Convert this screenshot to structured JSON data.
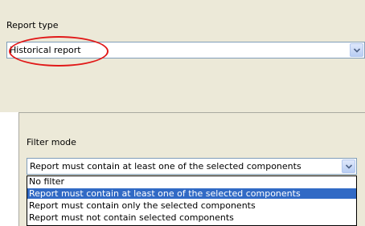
{
  "report": {
    "label": "Report type",
    "selected": "Historical report"
  },
  "filter": {
    "label": "Filter mode",
    "selected": "Report must contain at least one of the selected components",
    "options": [
      "No filter",
      "Report must contain at least one of the selected components",
      "Report must contain only the selected components",
      "Report must not contain selected components"
    ],
    "highlighted_index": 1
  },
  "colors": {
    "highlight": "#316ac5",
    "annotation": "#e11919",
    "panel_bg": "#ece9d8"
  },
  "icons": {
    "dropdown": "chevron-down-icon"
  }
}
